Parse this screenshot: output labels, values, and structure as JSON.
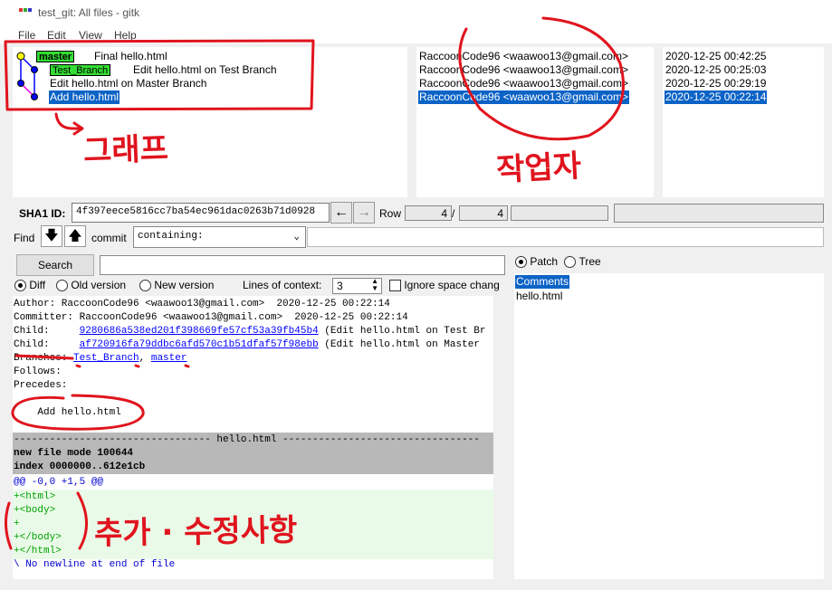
{
  "window": {
    "title": "test_git: All files - gitk"
  },
  "menu": {
    "file": "File",
    "edit": "Edit",
    "view": "View",
    "help": "Help"
  },
  "commits": [
    {
      "subject": "Final hello.html",
      "author": "RaccoonCode96 <waawoo13@gmail.com>",
      "date": "2020-12-25 00:42:25"
    },
    {
      "subject": "Edit hello.html on Test Branch",
      "author": "RaccoonCode96 <waawoo13@gmail.com>",
      "date": "2020-12-25 00:25:03"
    },
    {
      "subject": "Edit hello.html on Master Branch",
      "author": "RaccoonCode96 <waawoo13@gmail.com>",
      "date": "2020-12-25 00:29:19"
    },
    {
      "subject": "Add hello.html",
      "author": "RaccoonCode96 <waawoo13@gmail.com>",
      "date": "2020-12-25 00:22:14"
    }
  ],
  "branch_tags": {
    "master": "master",
    "test_branch": "Test_Branch"
  },
  "sha": {
    "label": "SHA1 ID:",
    "value": "4f397eece5816cc7ba54ec961dac0263b71d0928"
  },
  "row": {
    "label": "Row",
    "current": "4",
    "slash": "/",
    "total": "4"
  },
  "find": {
    "label": "Find",
    "commit_label": "commit",
    "type_value": "containing:"
  },
  "search": {
    "button": "Search"
  },
  "diff_options": {
    "diff": "Diff",
    "old": "Old version",
    "new": "New version",
    "context_label": "Lines of context:",
    "context_value": "3",
    "ignore_space": "Ignore space chang"
  },
  "view_options": {
    "patch": "Patch",
    "tree": "Tree"
  },
  "commit_details": {
    "author": "Author: RaccoonCode96 <waawoo13@gmail.com>  2020-12-25 00:22:14",
    "committer": "Committer: RaccoonCode96 <waawoo13@gmail.com>  2020-12-25 00:22:14",
    "child_label": "Child:",
    "child1_sha": "9280686a538ed201f398669fe57cf53a39fb45b4",
    "child1_desc": " (Edit hello.html on Test Br",
    "child2_sha": "af720916fa79ddbc6afd570c1b51dfaf57f98ebb",
    "child2_desc": " (Edit hello.html on Master ",
    "branches_label": "Branches:",
    "branch1": "Test_Branch",
    "branch_sep": ", ",
    "branch2": "master",
    "follows": "Follows:",
    "precedes": "Precedes:",
    "message": "    Add hello.html"
  },
  "diff": {
    "file_header": "--------------------------------- hello.html ---------------------------------",
    "mode": "new file mode 100644",
    "index": "index 0000000..612e1cb",
    "hunk": "@@ -0,0 +1,5 @@",
    "added_lines": [
      "+<html>",
      "+<body>",
      "+",
      "+</body>",
      "+</html>"
    ],
    "no_newline": "\\ No newline at end of file"
  },
  "files": {
    "comments": "Comments",
    "file1": "hello.html"
  },
  "annotations": {
    "graph": "그래프",
    "author": "작업자",
    "changes": "추가 · 수정사항"
  },
  "colors": {
    "selection": "#0c63c6",
    "branch_tag": "#33dd33",
    "annotation": "#e0141e",
    "graph_blue": "#0000ff",
    "graph_magenta": "#e000e0"
  }
}
